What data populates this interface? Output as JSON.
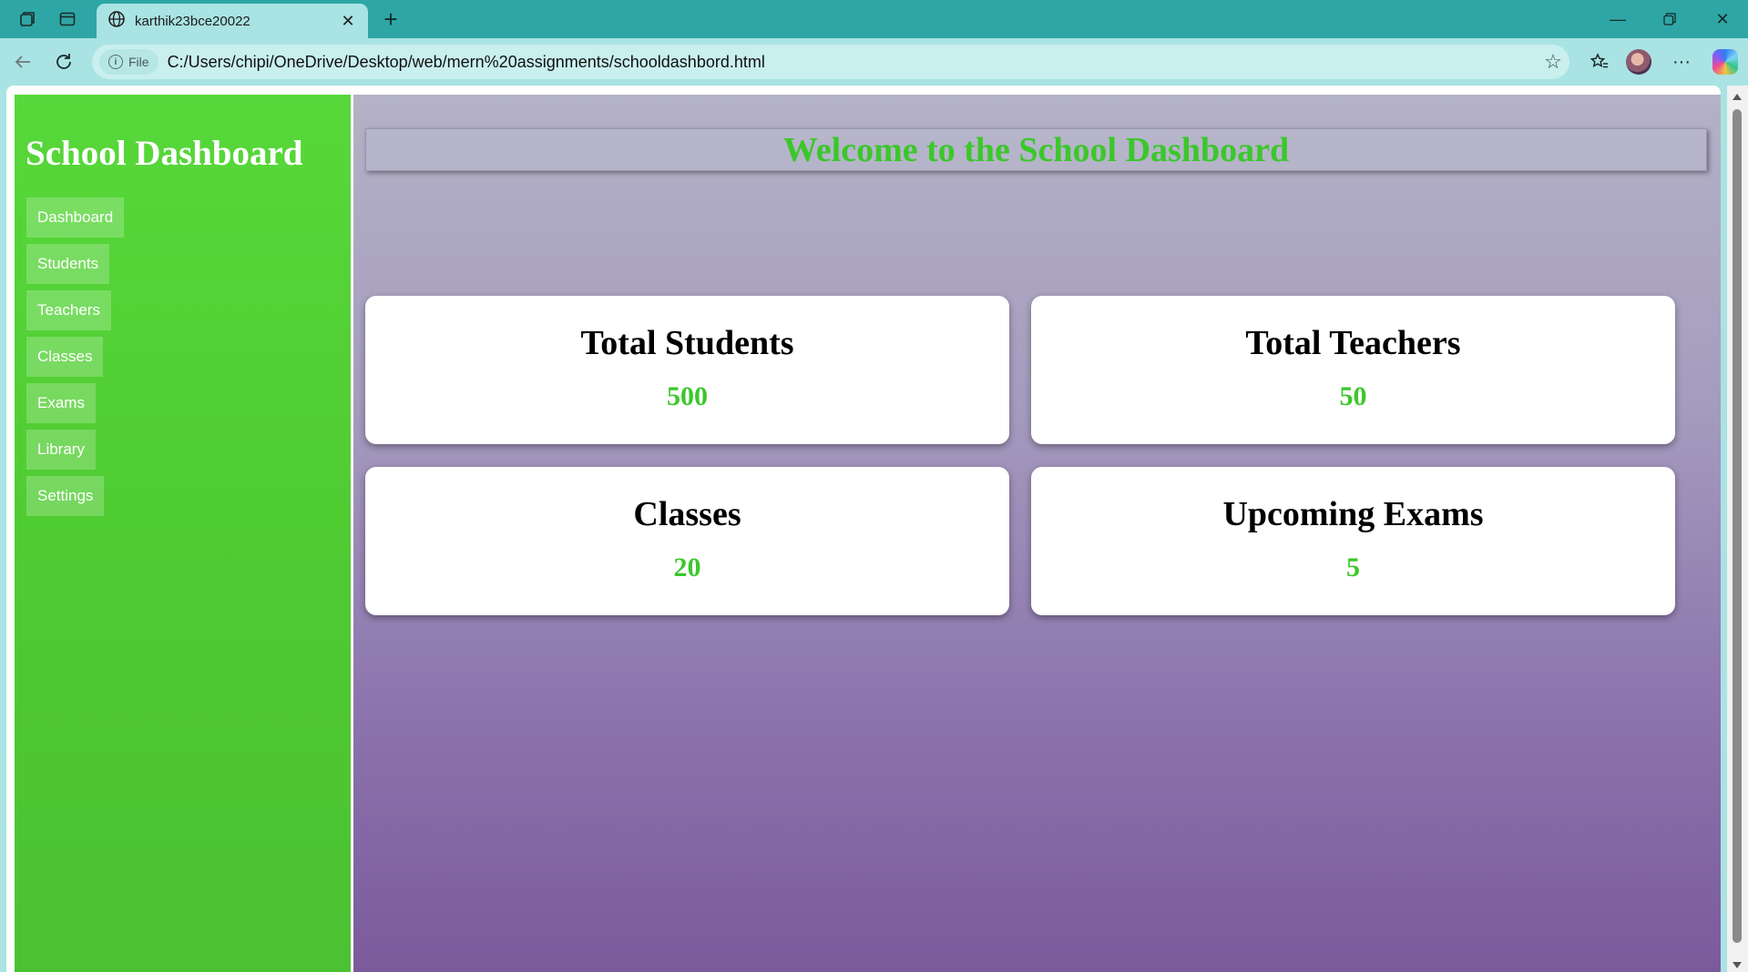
{
  "browser": {
    "tab_title": "karthik23bce20022",
    "file_label": "File",
    "url": "C:/Users/chipi/OneDrive/Desktop/web/mern%20assignments/schooldashbord.html"
  },
  "sidebar": {
    "title": "School Dashboard",
    "items": [
      {
        "label": "Dashboard"
      },
      {
        "label": "Students"
      },
      {
        "label": "Teachers"
      },
      {
        "label": "Classes"
      },
      {
        "label": "Exams"
      },
      {
        "label": "Library"
      },
      {
        "label": "Settings"
      }
    ]
  },
  "main": {
    "welcome": "Welcome to the School Dashboard",
    "cards": [
      {
        "title": "Total Students",
        "value": "500"
      },
      {
        "title": "Total Teachers",
        "value": "50"
      },
      {
        "title": "Classes",
        "value": "20"
      },
      {
        "title": "Upcoming Exams",
        "value": "5"
      }
    ]
  },
  "colors": {
    "sidebar_bg": "#52d236",
    "accent_green": "#3bc72b",
    "browser_teal": "#2fa6a6",
    "main_gradient_top": "#b4b2c6",
    "main_gradient_bottom": "#7b5a9c"
  }
}
